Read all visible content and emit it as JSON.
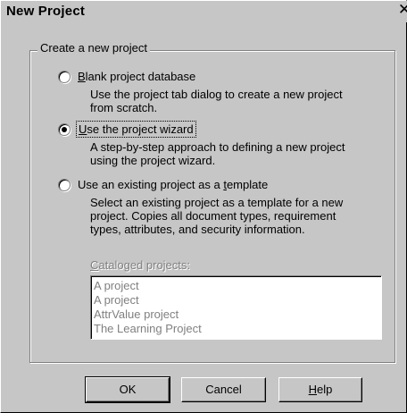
{
  "window": {
    "title": "New Project",
    "close_glyph": "✕"
  },
  "group": {
    "legend": "Create a new project"
  },
  "options": [
    {
      "label_pre": "",
      "label_key": "B",
      "label_post": "lank project database",
      "selected": false,
      "description": [
        "Use the project tab dialog to create a new project",
        "from scratch."
      ]
    },
    {
      "label_pre": "",
      "label_key": "U",
      "label_post": "se the project wizard",
      "selected": true,
      "description": [
        "A step-by-step approach to defining a new project",
        "using the project wizard."
      ]
    },
    {
      "label_pre": "Use an existing project as a ",
      "label_key": "t",
      "label_post": "emplate",
      "selected": false,
      "description": [
        "Select an existing project as a template for a new",
        "project. Copies all document types, requirement",
        "types, attributes, and security information."
      ]
    }
  ],
  "catalog": {
    "label_key": "C",
    "label_post": "ataloged projects:",
    "items": [
      "A project",
      "A project",
      "AttrValue project",
      "The Learning Project"
    ]
  },
  "buttons": {
    "ok": "OK",
    "cancel": "Cancel",
    "help_key": "H",
    "help_post": "elp"
  }
}
